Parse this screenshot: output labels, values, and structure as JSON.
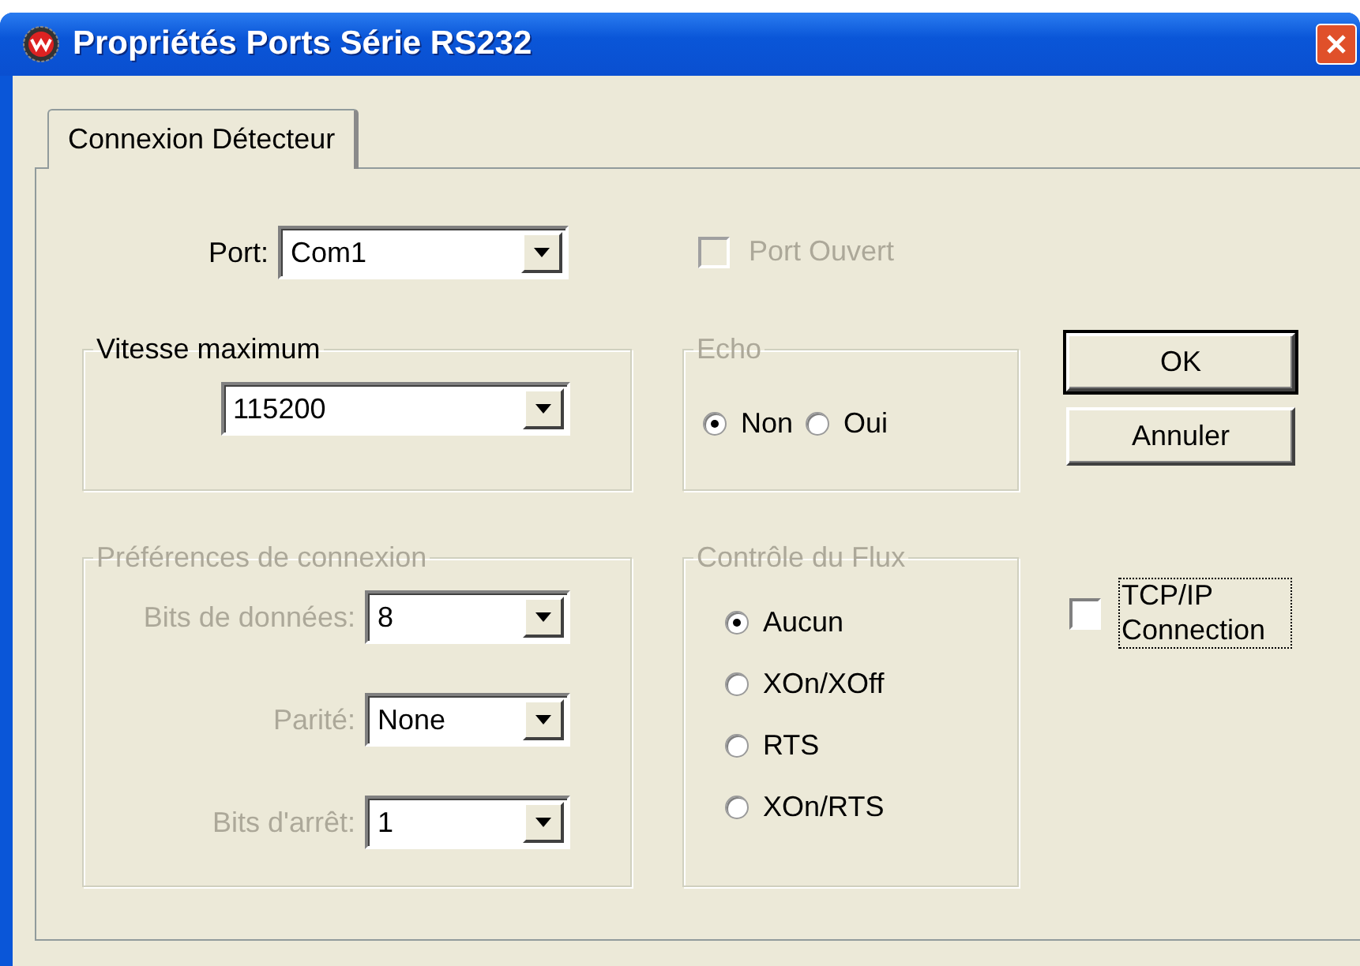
{
  "window": {
    "title": "Propriétés Ports Série RS232"
  },
  "tabs": [
    {
      "label": "Connexion Détecteur",
      "selected": true
    }
  ],
  "port": {
    "label": "Port:",
    "value": "Com1"
  },
  "port_open": {
    "label": "Port Ouvert",
    "checked": false,
    "disabled": true
  },
  "speed_group": {
    "title": "Vitesse maximum",
    "disabled": false,
    "value": "115200"
  },
  "echo_group": {
    "title": "Echo",
    "disabled": true,
    "options": [
      {
        "label": "Non",
        "selected": true
      },
      {
        "label": "Oui",
        "selected": false
      }
    ]
  },
  "buttons": [
    {
      "label": "OK",
      "default": true
    },
    {
      "label": "Annuler",
      "default": false
    }
  ],
  "preferences_group": {
    "title": "Préférences de connexion",
    "disabled": true,
    "fields": [
      {
        "label": "Bits de données:",
        "value": "8"
      },
      {
        "label": "Parité:",
        "value": "None"
      },
      {
        "label": "Bits d'arrêt:",
        "value": "1"
      }
    ]
  },
  "flow_group": {
    "title": "Contrôle du Flux",
    "disabled": true,
    "options": [
      {
        "label": "Aucun",
        "selected": true
      },
      {
        "label": "XOn/XOff",
        "selected": false
      },
      {
        "label": "RTS",
        "selected": false
      },
      {
        "label": "XOn/RTS",
        "selected": false
      }
    ]
  },
  "tcp_ip": {
    "label": "TCP/IP Connection",
    "checked": false,
    "focused": true
  }
}
